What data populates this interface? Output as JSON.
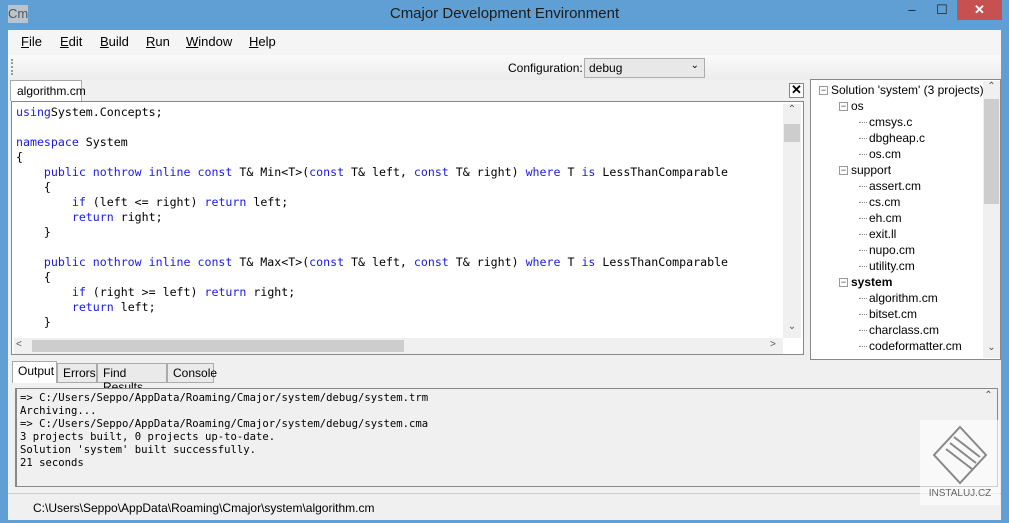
{
  "window": {
    "title": "Cmajor Development Environment",
    "icon_text": "Cm",
    "minimize": "–",
    "maximize": "☐",
    "close": "✕"
  },
  "menu": [
    {
      "label": "File",
      "ul": "F",
      "rest": "ile"
    },
    {
      "label": "Edit",
      "ul": "E",
      "rest": "dit"
    },
    {
      "label": "Build",
      "ul": "B",
      "rest": "uild"
    },
    {
      "label": "Run",
      "ul": "R",
      "rest": "un"
    },
    {
      "label": "Window",
      "ul": "W",
      "rest": "indow"
    },
    {
      "label": "Help",
      "ul": "H",
      "rest": "elp"
    }
  ],
  "toolbar": {
    "config_label": "Configuration:",
    "config_value": "debug"
  },
  "editor": {
    "tab": "algorithm.cm",
    "close": "✕",
    "lines": [
      [
        [
          "kw",
          "using"
        ],
        [
          "",
          "System.Concepts;"
        ]
      ],
      [],
      [
        [
          "kw",
          "namespace"
        ],
        [
          "",
          " System"
        ]
      ],
      [
        [
          "",
          "{"
        ]
      ],
      [
        [
          "",
          "    "
        ],
        [
          "kw",
          "public nothrow inline const"
        ],
        [
          "",
          " T& Min<T>("
        ],
        [
          "kw",
          "const"
        ],
        [
          "",
          " T& left, "
        ],
        [
          "kw",
          "const"
        ],
        [
          "",
          " T& right) "
        ],
        [
          "kw",
          "where"
        ],
        [
          "",
          " T "
        ],
        [
          "kw",
          "is"
        ],
        [
          "",
          " LessThanComparable"
        ]
      ],
      [
        [
          "",
          "    {"
        ]
      ],
      [
        [
          "",
          "        "
        ],
        [
          "kw",
          "if"
        ],
        [
          "",
          " (left <= right) "
        ],
        [
          "kw",
          "return"
        ],
        [
          "",
          " left;"
        ]
      ],
      [
        [
          "",
          "        "
        ],
        [
          "kw",
          "return"
        ],
        [
          "",
          " right;"
        ]
      ],
      [
        [
          "",
          "    }"
        ]
      ],
      [],
      [
        [
          "",
          "    "
        ],
        [
          "kw",
          "public nothrow inline const"
        ],
        [
          "",
          " T& Max<T>("
        ],
        [
          "kw",
          "const"
        ],
        [
          "",
          " T& left, "
        ],
        [
          "kw",
          "const"
        ],
        [
          "",
          " T& right) "
        ],
        [
          "kw",
          "where"
        ],
        [
          "",
          " T "
        ],
        [
          "kw",
          "is"
        ],
        [
          "",
          " LessThanComparable"
        ]
      ],
      [
        [
          "",
          "    {"
        ]
      ],
      [
        [
          "",
          "        "
        ],
        [
          "kw",
          "if"
        ],
        [
          "",
          " (right >= left) "
        ],
        [
          "kw",
          "return"
        ],
        [
          "",
          " right;"
        ]
      ],
      [
        [
          "",
          "        "
        ],
        [
          "kw",
          "return"
        ],
        [
          "",
          " left;"
        ]
      ],
      [
        [
          "",
          "    }"
        ]
      ]
    ]
  },
  "tree": {
    "nodes": [
      {
        "label": "Solution 'system' (3 projects)",
        "level": 0,
        "expander": "−"
      },
      {
        "label": "os",
        "level": 1,
        "expander": "−"
      },
      {
        "label": "cmsys.c",
        "level": 2
      },
      {
        "label": "dbgheap.c",
        "level": 2
      },
      {
        "label": "os.cm",
        "level": 2
      },
      {
        "label": "support",
        "level": 1,
        "expander": "−"
      },
      {
        "label": "assert.cm",
        "level": 2
      },
      {
        "label": "cs.cm",
        "level": 2
      },
      {
        "label": "eh.cm",
        "level": 2
      },
      {
        "label": "exit.ll",
        "level": 2
      },
      {
        "label": "nupo.cm",
        "level": 2
      },
      {
        "label": "utility.cm",
        "level": 2
      },
      {
        "label": "system",
        "level": 1,
        "expander": "−",
        "bold": true
      },
      {
        "label": "algorithm.cm",
        "level": 2
      },
      {
        "label": "bitset.cm",
        "level": 2
      },
      {
        "label": "charclass.cm",
        "level": 2
      },
      {
        "label": "codeformatter.cm",
        "level": 2
      }
    ]
  },
  "output": {
    "tabs": [
      "Output",
      "Errors",
      "Find Results",
      "Console"
    ],
    "active": "Output",
    "text": "=> C:/Users/Seppo/AppData/Roaming/Cmajor/system/debug/system.trm\nArchiving...\n=> C:/Users/Seppo/AppData/Roaming/Cmajor/system/debug/system.cma\n3 projects built, 0 projects up-to-date.\nSolution 'system' built successfully.\n21 seconds"
  },
  "status": {
    "path": "C:\\Users\\Seppo\\AppData\\Roaming\\Cmajor\\system\\algorithm.cm"
  },
  "watermark": {
    "text": "INSTALUJ.CZ"
  },
  "colors": {
    "titlebar": "#5f9fd3",
    "keyword": "#1a1ae6",
    "close": "#c75050"
  }
}
